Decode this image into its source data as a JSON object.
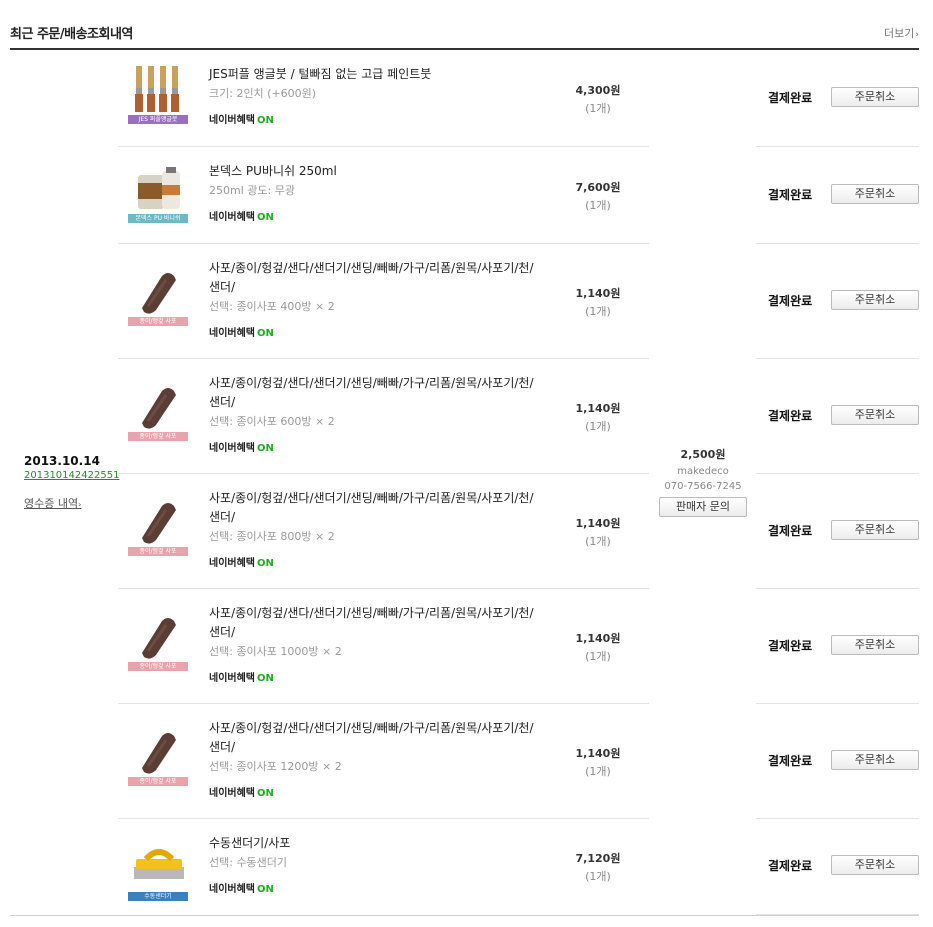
{
  "header": {
    "title": "최근 주문/배송조회내역",
    "more": "더보기",
    "more_arrow": "›"
  },
  "order": {
    "date": "2013.10.14",
    "order_no": "2013101424225​51",
    "receipt": "영수증 내역",
    "receipt_arrow": "›"
  },
  "seller": {
    "shipping": "2,500원",
    "name": "makedeco",
    "phone": "070-7566-7245",
    "ask_button": "판매자 문의"
  },
  "benefit": {
    "label": "네이버혜택",
    "on": "ON"
  },
  "items": [
    {
      "name": "JES퍼플 앵글붓 / 털빠짐 없는 고급 페인트붓",
      "option": "크기: 2인치 (+600원)",
      "price": "4,300원",
      "qty": "(1개)",
      "status": "결제완료",
      "cancel": "주문취소",
      "thumb_tag": "JES 퍼플앵글붓",
      "thumb_icon": "brush-set-icon",
      "tag_color": "#9a6fc4"
    },
    {
      "name": "본덱스 PU바니쉬 250ml",
      "option": "250ml 광도: 무광",
      "price": "7,600원",
      "qty": "(1개)",
      "status": "결제완료",
      "cancel": "주문취소",
      "thumb_tag": "본덱스 PU 바니쉬",
      "thumb_icon": "varnish-can-icon",
      "tag_color": "#6cb8c8"
    },
    {
      "name": "사포/종이/헝겊/샌다/샌더기/샌딩/빼빠/가구/리폼/원목/사포기/천/샌더/",
      "option": "선택: 종이사포 400방 × 2",
      "price": "1,140원",
      "qty": "(1개)",
      "status": "결제완료",
      "cancel": "주문취소",
      "thumb_tag": "종이/헝겊 사포",
      "thumb_icon": "sandpaper-icon",
      "tag_color": "#e9a3ad"
    },
    {
      "name": "사포/종이/헝겊/샌다/샌더기/샌딩/빼빠/가구/리폼/원목/사포기/천/샌더/",
      "option": "선택: 종이사포 600방 × 2",
      "price": "1,140원",
      "qty": "(1개)",
      "status": "결제완료",
      "cancel": "주문취소",
      "thumb_tag": "종이/헝겊 사포",
      "thumb_icon": "sandpaper-icon",
      "tag_color": "#e9a3ad"
    },
    {
      "name": "사포/종이/헝겊/샌다/샌더기/샌딩/빼빠/가구/리폼/원목/사포기/천/샌더/",
      "option": "선택: 종이사포 800방 × 2",
      "price": "1,140원",
      "qty": "(1개)",
      "status": "결제완료",
      "cancel": "주문취소",
      "thumb_tag": "종이/헝겊 사포",
      "thumb_icon": "sandpaper-icon",
      "tag_color": "#e9a3ad"
    },
    {
      "name": "사포/종이/헝겊/샌다/샌더기/샌딩/빼빠/가구/리폼/원목/사포기/천/샌더/",
      "option": "선택: 종이사포 1000방 × 2",
      "price": "1,140원",
      "qty": "(1개)",
      "status": "결제완료",
      "cancel": "주문취소",
      "thumb_tag": "종이/헝겊 사포",
      "thumb_icon": "sandpaper-icon",
      "tag_color": "#e9a3ad"
    },
    {
      "name": "사포/종이/헝겊/샌다/샌더기/샌딩/빼빠/가구/리폼/원목/사포기/천/샌더/",
      "option": "선택: 종이사포 1200방 × 2",
      "price": "1,140원",
      "qty": "(1개)",
      "status": "결제완료",
      "cancel": "주문취소",
      "thumb_tag": "종이/헝겊 사포",
      "thumb_icon": "sandpaper-icon",
      "tag_color": "#e9a3ad"
    },
    {
      "name": "수동샌더기/사포",
      "option": "선택: 수동샌더기",
      "price": "7,120원",
      "qty": "(1개)",
      "status": "결제완료",
      "cancel": "주문취소",
      "thumb_tag": "수동샌더기",
      "thumb_icon": "hand-sander-icon",
      "tag_color": "#3a7fc0"
    }
  ]
}
